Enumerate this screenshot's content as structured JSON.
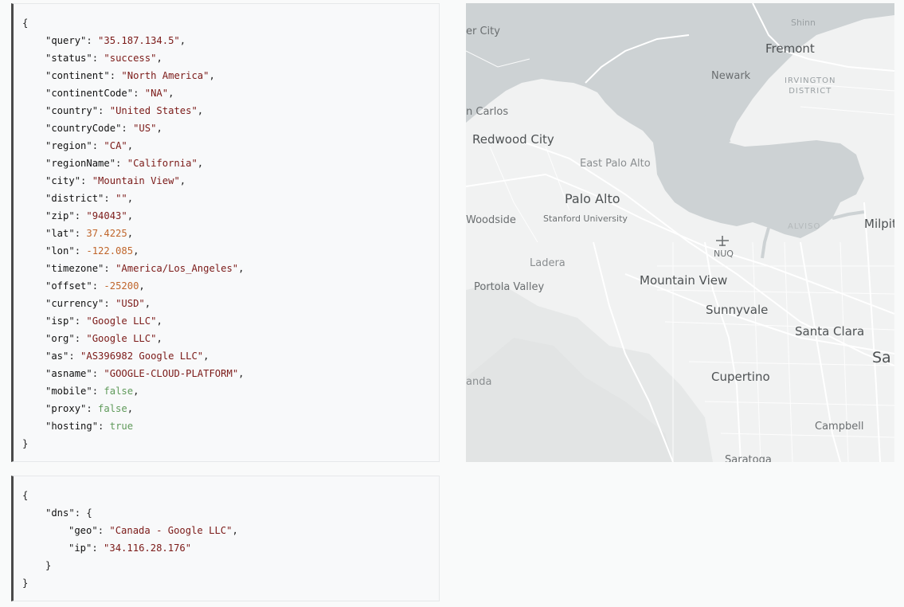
{
  "ip_info": {
    "lines": [
      {
        "key": "query",
        "value": "\"35.187.134.5\"",
        "type": "str"
      },
      {
        "key": "status",
        "value": "\"success\"",
        "type": "str"
      },
      {
        "key": "continent",
        "value": "\"North America\"",
        "type": "str"
      },
      {
        "key": "continentCode",
        "value": "\"NA\"",
        "type": "str"
      },
      {
        "key": "country",
        "value": "\"United States\"",
        "type": "str"
      },
      {
        "key": "countryCode",
        "value": "\"US\"",
        "type": "str"
      },
      {
        "key": "region",
        "value": "\"CA\"",
        "type": "str"
      },
      {
        "key": "regionName",
        "value": "\"California\"",
        "type": "str"
      },
      {
        "key": "city",
        "value": "\"Mountain View\"",
        "type": "str"
      },
      {
        "key": "district",
        "value": "\"\"",
        "type": "str"
      },
      {
        "key": "zip",
        "value": "\"94043\"",
        "type": "str"
      },
      {
        "key": "lat",
        "value": "37.4225",
        "type": "num"
      },
      {
        "key": "lon",
        "value": "-122.085",
        "type": "num"
      },
      {
        "key": "timezone",
        "value": "\"America/Los_Angeles\"",
        "type": "str"
      },
      {
        "key": "offset",
        "value": "-25200",
        "type": "num"
      },
      {
        "key": "currency",
        "value": "\"USD\"",
        "type": "str"
      },
      {
        "key": "isp",
        "value": "\"Google LLC\"",
        "type": "str"
      },
      {
        "key": "org",
        "value": "\"Google LLC\"",
        "type": "str"
      },
      {
        "key": "as",
        "value": "\"AS396982 Google LLC\"",
        "type": "str"
      },
      {
        "key": "asname",
        "value": "\"GOOGLE-CLOUD-PLATFORM\"",
        "type": "str"
      },
      {
        "key": "mobile",
        "value": "false",
        "type": "bool"
      },
      {
        "key": "proxy",
        "value": "false",
        "type": "bool"
      },
      {
        "key": "hosting",
        "value": "true",
        "type": "bool"
      }
    ]
  },
  "dns_info": {
    "outer_key": "dns",
    "lines": [
      {
        "key": "geo",
        "value": "\"Canada - Google LLC\"",
        "type": "str"
      },
      {
        "key": "ip",
        "value": "\"34.116.28.176\"",
        "type": "str"
      }
    ]
  },
  "punctuation": {
    "open_brace": "{",
    "close_brace": "}"
  },
  "map": {
    "labels": {
      "fremont": "Fremont",
      "shinn": "Shinn",
      "newark": "Newark",
      "irvington": "IRVINGTON",
      "district": "DISTRICT",
      "city_partial": "er City",
      "san_carlos": "n Carlos",
      "redwood_city": "Redwood City",
      "east_palo_alto": "East Palo Alto",
      "palo_alto": "Palo Alto",
      "woodside": "Woodside",
      "stanford": "Stanford University",
      "alviso": "ALVISO",
      "milpitas": "Milpit",
      "nuq": "NUQ",
      "ladera": "Ladera",
      "portola_valley": "Portola Valley",
      "mountain_view": "Mountain View",
      "sunnyvale": "Sunnyvale",
      "santa_clara": "Santa Clara",
      "san_jose_partial": "Sa",
      "cupertino": "Cupertino",
      "anda": "anda",
      "campbell": "Campbell",
      "saratoga": "Saratoga"
    },
    "colors": {
      "water": "#cdd2d4",
      "land": "#f1f2f2",
      "roads": "#ffffff",
      "hills": "#e4e6e6"
    }
  }
}
